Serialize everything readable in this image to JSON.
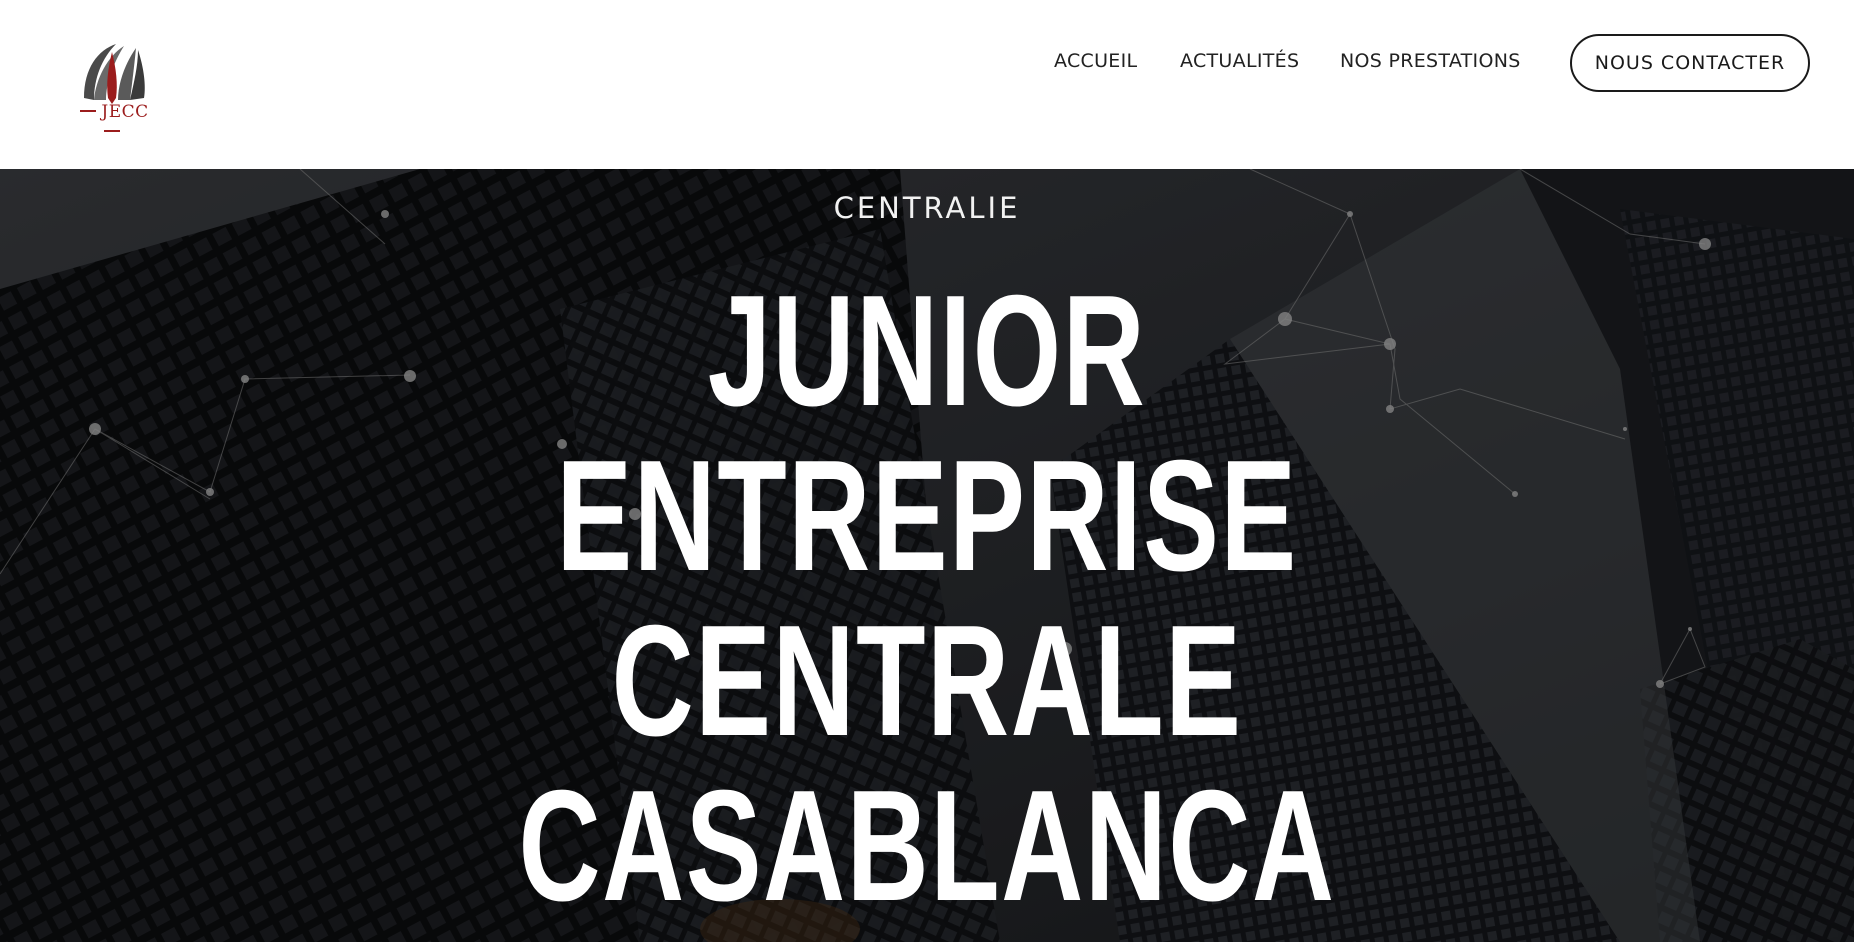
{
  "header": {
    "logo": {
      "icon": "jecc-arches-logo-icon",
      "text": "JECC",
      "colors": {
        "dark": "#3a3a3a",
        "red": "#9b1c1c"
      }
    },
    "nav": {
      "items": [
        {
          "label": "ACCUEIL"
        },
        {
          "label": "ACTUALITÉS"
        },
        {
          "label": "NOS PRESTATIONS"
        }
      ]
    },
    "cta": {
      "label": "NOUS CONTACTER"
    }
  },
  "hero": {
    "background": "dark-skyscrapers-network-lines-photo",
    "eyebrow": "CENTRALIE",
    "title_lines": [
      "JUNIOR",
      "ENTREPRISE",
      "CENTRALE",
      "CASABLANCA"
    ]
  },
  "colors": {
    "text_dark": "#222222",
    "hero_text": "#ffffff",
    "hero_bg": "#16181b"
  }
}
